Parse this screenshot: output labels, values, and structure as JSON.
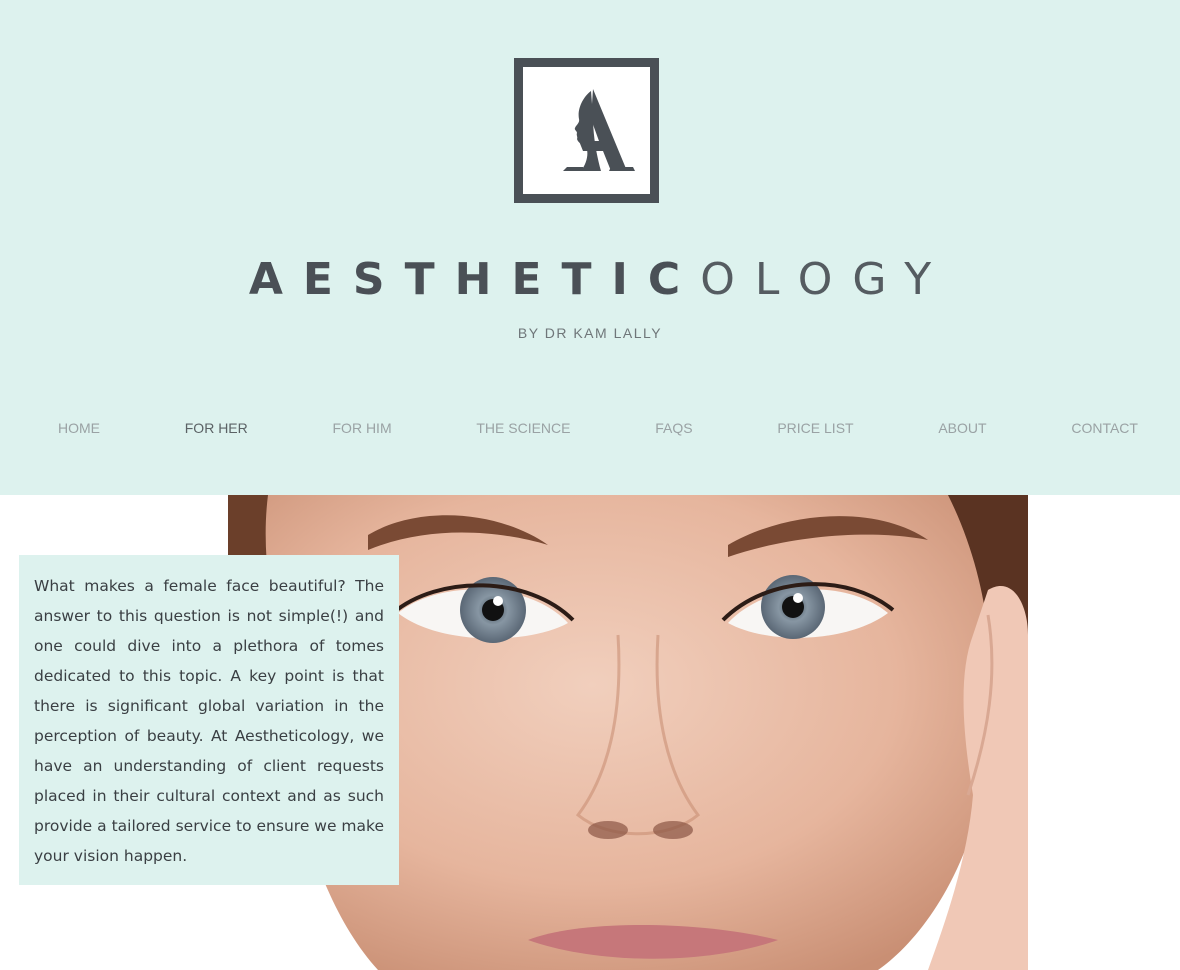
{
  "brand": {
    "title_bold": "AESTHETIC",
    "title_light": "OLOGY",
    "subtitle": "BY DR KAM LALLY"
  },
  "nav": {
    "items": [
      {
        "label": "HOME"
      },
      {
        "label": "FOR HER"
      },
      {
        "label": "FOR HIM"
      },
      {
        "label": "THE SCIENCE"
      },
      {
        "label": "FAQS"
      },
      {
        "label": "PRICE LIST"
      },
      {
        "label": "ABOUT"
      },
      {
        "label": "CONTACT"
      }
    ],
    "active": "FOR HER"
  },
  "intro": {
    "text": "What makes a female face beautiful? The answer to this question is not simple(!) and one could dive into a plethora of tomes dedicated to this topic. A key point is that there is significant global variation in the perception of beauty. At Aestheticology, we have an understanding of client requests placed in their cultural context and as such provide a tailored service to ensure we make your vision happen."
  },
  "colors": {
    "header_bg": "#ddf2ee",
    "brand_dark": "#4a5056",
    "nav_text": "#9aa2a4",
    "nav_active": "#5b6265"
  }
}
